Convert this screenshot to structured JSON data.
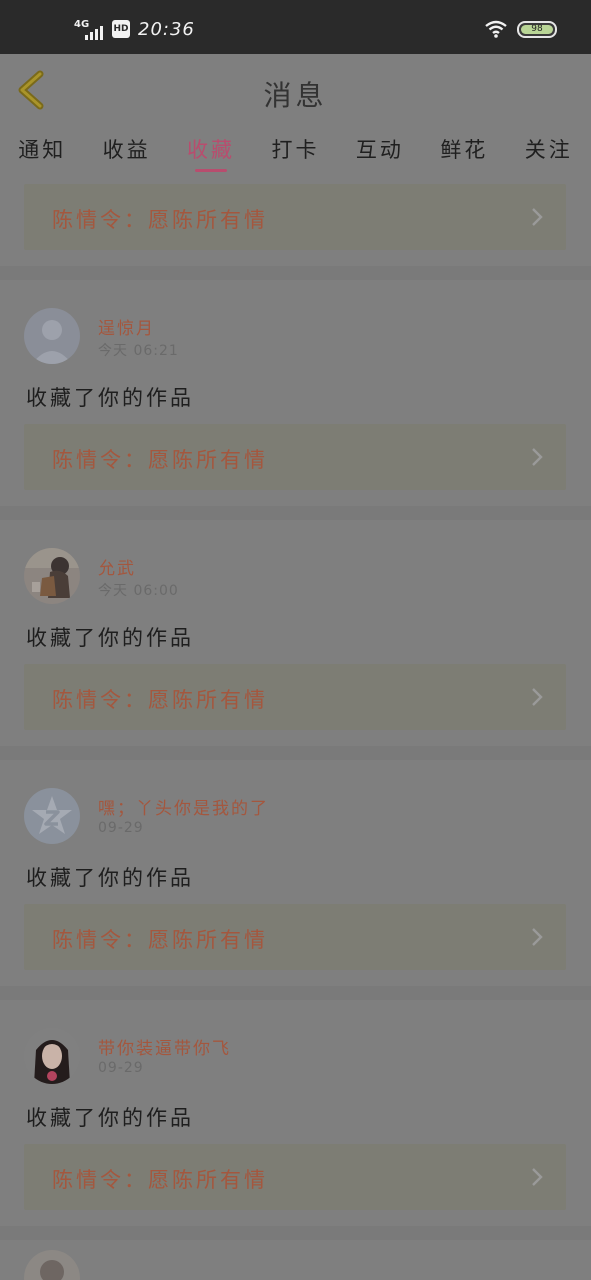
{
  "status_bar": {
    "network": "4G",
    "hd": "HD",
    "time": "20:36",
    "battery": "98"
  },
  "header": {
    "title": "消息"
  },
  "tabs": [
    {
      "label": "通知"
    },
    {
      "label": "收益"
    },
    {
      "label": "收藏",
      "active": true
    },
    {
      "label": "打卡"
    },
    {
      "label": "互动"
    },
    {
      "label": "鲜花"
    },
    {
      "label": "关注"
    }
  ],
  "top_item": {
    "work_title": "陈情令：愿陈所有情"
  },
  "messages": [
    {
      "username": "逞惊月",
      "time": "今天 06:21",
      "action": "收藏了你的作品",
      "work_title": "陈情令：愿陈所有情",
      "avatar_icon": "default-avatar-icon"
    },
    {
      "username": "允武",
      "time": "今天 06:00",
      "action": "收藏了你的作品",
      "work_title": "陈情令：愿陈所有情",
      "avatar_icon": "photo-avatar-icon"
    },
    {
      "username": "嘿；丫头你是我的了",
      "time": "09-29",
      "action": "收藏了你的作品",
      "work_title": "陈情令：愿陈所有情",
      "avatar_icon": "z-logo-avatar-icon"
    },
    {
      "username": "带你装逼带你飞",
      "time": "09-29",
      "action": "收藏了你的作品",
      "work_title": "陈情令：愿陈所有情",
      "avatar_icon": "girl-avatar-icon"
    }
  ],
  "colors": {
    "accent": "#b84d6e",
    "username": "#a4573e",
    "overlay_bg": "#7f7f7f",
    "status_bar": "#2a2a2a"
  }
}
